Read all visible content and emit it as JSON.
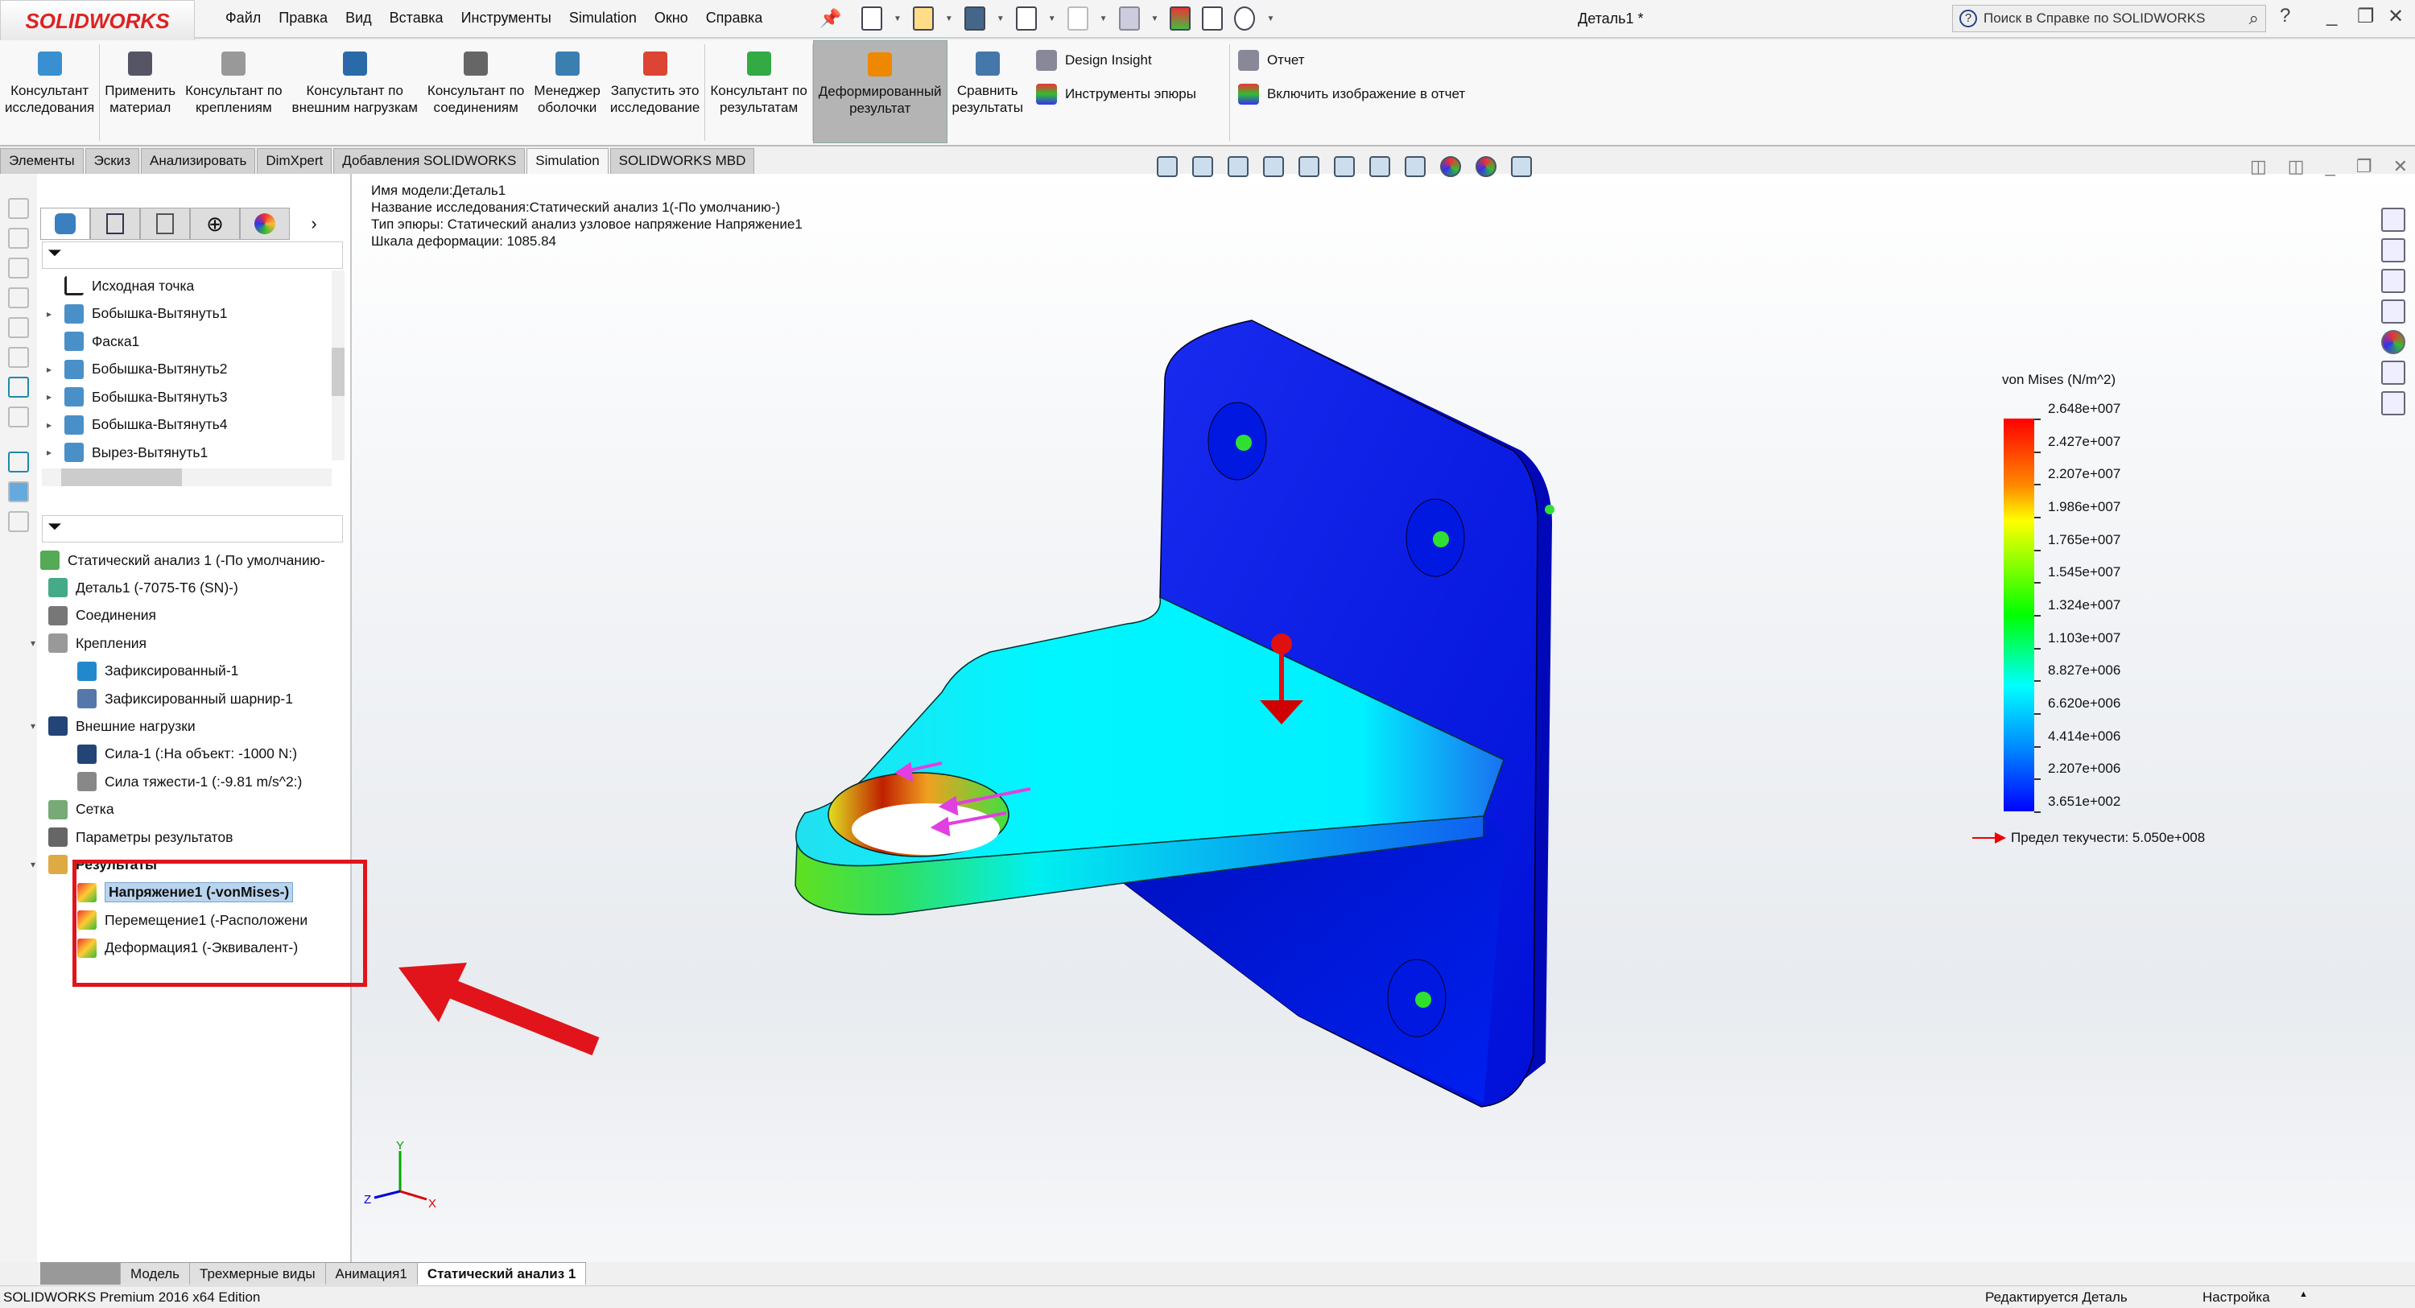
{
  "app": {
    "logo": "SOLIDWORKS",
    "document_title": "Деталь1 *",
    "help_search_placeholder": "Поиск в Справке по SOLIDWORKS"
  },
  "menu": [
    "Файл",
    "Правка",
    "Вид",
    "Вставка",
    "Инструменты",
    "Simulation",
    "Окно",
    "Справка"
  ],
  "ribbon": {
    "buttons": [
      {
        "label1": "Консультант",
        "label2": "исследования",
        "icon": "study-advisor-icon",
        "color": "#3a8fd0"
      },
      {
        "label1": "Применить",
        "label2": "материал",
        "icon": "apply-material-icon",
        "color": "#556"
      },
      {
        "label1": "Консультант по",
        "label2": "креплениям",
        "icon": "fixtures-advisor-icon",
        "color": "#999"
      },
      {
        "label1": "Консультант по",
        "label2": "внешним нагрузкам",
        "icon": "external-loads-icon",
        "color": "#2a6aa8"
      },
      {
        "label1": "Консультант по",
        "label2": "соединениям",
        "icon": "connections-icon",
        "color": "#666"
      },
      {
        "label1": "Менеджер",
        "label2": "оболочки",
        "icon": "shell-manager-icon",
        "color": "#3a7fb0"
      },
      {
        "label1": "Запустить это",
        "label2": "исследование",
        "icon": "run-study-icon",
        "color": "#d43"
      },
      {
        "label1": "Консультант по",
        "label2": "результатам",
        "icon": "results-advisor-icon",
        "color": "#3a4"
      },
      {
        "label1": "Деформированный",
        "label2": "результат",
        "icon": "deformed-result-icon",
        "color": "#e80",
        "active": true
      },
      {
        "label1": "Сравнить",
        "label2": "результаты",
        "icon": "compare-results-icon",
        "color": "#47a"
      }
    ],
    "small": [
      {
        "label": "Design Insight",
        "icon": "design-insight-icon"
      },
      {
        "label": "Инструменты эпюры",
        "icon": "plot-tools-icon"
      }
    ],
    "report": [
      {
        "label": "Отчет",
        "icon": "report-icon"
      },
      {
        "label": "Включить изображение в отчет",
        "icon": "include-image-icon"
      }
    ]
  },
  "tabs": [
    {
      "label": "Элементы"
    },
    {
      "label": "Эскиз"
    },
    {
      "label": "Анализировать"
    },
    {
      "label": "DimXpert"
    },
    {
      "label": "Добавления SOLIDWORKS"
    },
    {
      "label": "Simulation",
      "active": true
    },
    {
      "label": "SOLIDWORKS MBD"
    }
  ],
  "feature_tree": [
    {
      "label": "Исходная точка",
      "expand": false
    },
    {
      "label": "Бобышка-Вытянуть1",
      "expand": true
    },
    {
      "label": "Фаска1",
      "expand": false
    },
    {
      "label": "Бобышка-Вытянуть2",
      "expand": true
    },
    {
      "label": "Бобышка-Вытянуть3",
      "expand": true
    },
    {
      "label": "Бобышка-Вытянуть4",
      "expand": true
    },
    {
      "label": "Вырез-Вытянуть1",
      "expand": true
    }
  ],
  "study_tree": [
    {
      "label": "Статический анализ 1 (-По умолчанию-",
      "level": 0
    },
    {
      "label": "Деталь1 (-7075-T6 (SN)-)",
      "level": 1
    },
    {
      "label": "Соединения",
      "level": 1
    },
    {
      "label": "Крепления",
      "level": 1,
      "expanded": true
    },
    {
      "label": "Зафиксированный-1",
      "level": 2
    },
    {
      "label": "Зафиксированный шарнир-1",
      "level": 2
    },
    {
      "label": "Внешние нагрузки",
      "level": 1,
      "expanded": true
    },
    {
      "label": "Сила-1 (:На объект: -1000 N:)",
      "level": 2
    },
    {
      "label": "Сила тяжести-1 (:-9.81 m/s^2:)",
      "level": 2
    },
    {
      "label": "Сетка",
      "level": 1
    },
    {
      "label": "Параметры результатов",
      "level": 1
    },
    {
      "label": "Результаты",
      "level": 1,
      "expanded": true,
      "bold": true
    },
    {
      "label": "Напряжение1 (-vonMises-)",
      "level": 2,
      "selected": true
    },
    {
      "label": "Перемещение1 (-Расположени",
      "level": 2
    },
    {
      "label": "Деформация1 (-Эквивалент-)",
      "level": 2
    }
  ],
  "viewport_info": [
    "Имя модели:Деталь1",
    "Название исследования:Статический анализ 1(-По умолчанию-)",
    "Тип эпюры: Статический анализ узловое напряжение Напряжение1",
    "Шкала деформации: 1085.84"
  ],
  "legend": {
    "title": "von Mises (N/m^2)",
    "labels": [
      "2.648e+007",
      "2.427e+007",
      "2.207e+007",
      "1.986e+007",
      "1.765e+007",
      "1.545e+007",
      "1.324e+007",
      "1.103e+007",
      "8.827e+006",
      "6.620e+006",
      "4.414e+006",
      "2.207e+006",
      "3.651e+002"
    ],
    "yield": "Предел текучести: 5.050e+008"
  },
  "bottom_tabs": [
    {
      "label": "Модель"
    },
    {
      "label": "Трехмерные виды"
    },
    {
      "label": "Анимация1"
    },
    {
      "label": "Статический анализ 1",
      "active": true
    }
  ],
  "status": {
    "edition": "SOLIDWORKS Premium 2016 x64 Edition",
    "editing": "Редактируется Деталь",
    "settings": "Настройка"
  },
  "triad": {
    "x": "X",
    "y": "Y",
    "z": "Z"
  },
  "colors": {
    "highlight": "#e0141a",
    "stress_high": "#ff0000",
    "stress_low": "#0000ff"
  }
}
